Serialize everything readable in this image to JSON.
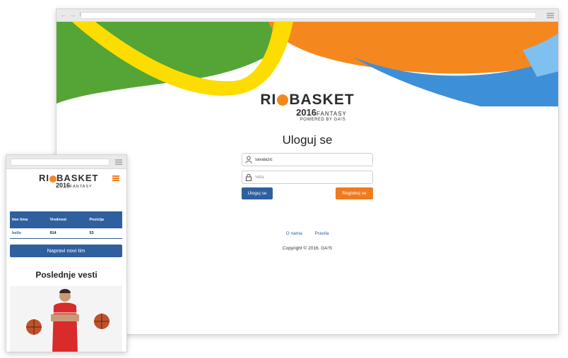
{
  "desktop": {
    "nav_icons": "← → ↻",
    "logo": {
      "word_rio_pre": "RI",
      "word_basket": "BASKET",
      "year": "2016",
      "fantasy": "FANTASY",
      "powered": "POWERED BY GA²S"
    },
    "title": "Uloguj se",
    "username_value": "savalazic",
    "password_placeholder": "Šifra",
    "login_label": "Uloguj se",
    "register_label": "Registruj se",
    "footer_links": [
      "O nama",
      "Pravila"
    ],
    "copyright": "Copyright © 2016. GA²S"
  },
  "mobile": {
    "logo": {
      "word_rio_pre": "RI",
      "word_basket": "BASKET",
      "year": "2016",
      "fantasy": "FANTASY"
    },
    "table": {
      "headers": [
        "Ime tima",
        "Vrednost",
        "Pozicija"
      ],
      "rows": [
        [
          "hello",
          "914",
          "53"
        ]
      ]
    },
    "new_team_label": "Napravi novi tim",
    "news_title": "Poslednje vesti"
  },
  "colors": {
    "green": "#54a536",
    "yellow": "#fddc00",
    "orange": "#f5871f",
    "blue": "#3d8fd8",
    "brand_blue": "#2f5f9e",
    "brand_orange": "#f07a1e"
  },
  "icons": [
    "user-icon",
    "lock-icon",
    "menu-icon",
    "basketball-icon"
  ]
}
